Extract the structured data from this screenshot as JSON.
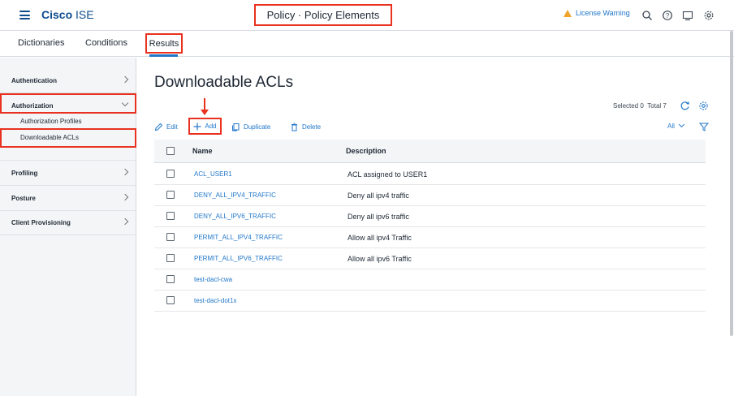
{
  "header": {
    "brand_prefix": "Cisco",
    "brand_suffix": " ISE",
    "page_title": "Policy · Policy Elements",
    "license_warning": "License Warning"
  },
  "tabs": [
    {
      "label": "Dictionaries"
    },
    {
      "label": "Conditions"
    },
    {
      "label": "Results",
      "active": true
    }
  ],
  "sidebar": {
    "items": [
      {
        "label": "Authentication",
        "expanded": false
      },
      {
        "label": "Authorization",
        "expanded": true
      },
      {
        "label": "Profiling",
        "expanded": false
      },
      {
        "label": "Posture",
        "expanded": false
      },
      {
        "label": "Client Provisioning",
        "expanded": false
      }
    ],
    "sub_items": [
      {
        "label": "Authorization Profiles"
      },
      {
        "label": "Downloadable ACLs",
        "selected": true
      }
    ]
  },
  "main": {
    "title": "Downloadable ACLs",
    "selected_label": "Selected 0",
    "total_label": "Total 7",
    "toolbar": {
      "edit": "Edit",
      "add": "Add",
      "duplicate": "Duplicate",
      "delete": "Delete",
      "filter_all": "All"
    },
    "columns": [
      "Name",
      "Description"
    ],
    "rows": [
      {
        "name": "ACL_USER1",
        "description": "ACL assigned to USER1"
      },
      {
        "name": "DENY_ALL_IPV4_TRAFFIC",
        "description": "Deny all ipv4 traffic"
      },
      {
        "name": "DENY_ALL_IPV6_TRAFFIC",
        "description": "Deny all ipv6 traffic"
      },
      {
        "name": "PERMIT_ALL_IPV4_TRAFFIC",
        "description": "Allow all ipv4 Traffic"
      },
      {
        "name": "PERMIT_ALL_IPV6_TRAFFIC",
        "description": "Allow all ipv6 Traffic"
      },
      {
        "name": "test-dacl-cwa",
        "description": ""
      },
      {
        "name": "test-dacl-dot1x",
        "description": ""
      }
    ]
  },
  "colors": {
    "brand": "#0d4b8c",
    "link": "#1f76c9",
    "highlight": "#e8311f",
    "warning": "#f0a42c"
  }
}
